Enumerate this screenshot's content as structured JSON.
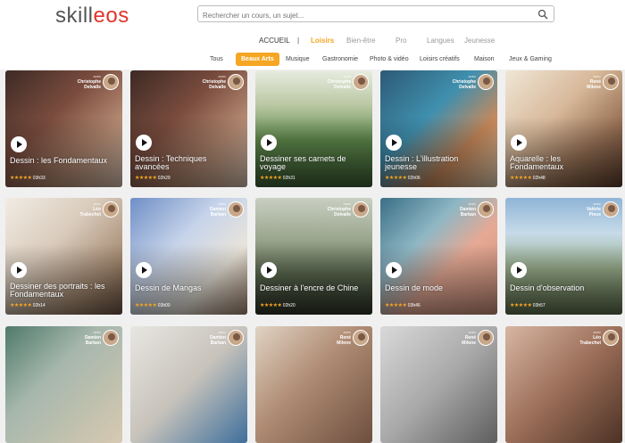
{
  "brand": {
    "logo_text_a": "skill",
    "logo_text_b": "eos"
  },
  "search": {
    "placeholder": "Rechercher un cours, un sujet..."
  },
  "topnav": {
    "home": "ACCUEIL",
    "separator": "|",
    "items": [
      "Loisirs",
      "Bien-être",
      "Pro",
      "Langues",
      "Jeunesse"
    ]
  },
  "categories": [
    "Tous",
    "Beaux Arts",
    "Musique",
    "Gastronomie",
    "Photo & vidéo",
    "Loisirs créatifs",
    "Maison",
    "Jeux & Gaming"
  ],
  "active_category": "Beaux Arts",
  "colors": {
    "accent": "#f5a623",
    "brand_red": "#e0352b",
    "header_bg": "#ffffff",
    "page_bg": "#f0f0f0"
  },
  "courses": [
    {
      "avec": "avec",
      "author_1": "Christophe",
      "author_2": "Delvalle",
      "title_1": "Dessin : les Fondamentaux",
      "title_2": "",
      "stars": "★★★★★",
      "duration": "03h33"
    },
    {
      "avec": "avec",
      "author_1": "Christophe",
      "author_2": "Delvalle",
      "title_1": "Dessin : Techniques",
      "title_2": "avancées",
      "stars": "★★★★★",
      "duration": "02h29"
    },
    {
      "avec": "avec",
      "author_1": "Christophe",
      "author_2": "Delvalle",
      "title_1": "Dessiner ses carnets de",
      "title_2": "voyage",
      "stars": "★★★★★",
      "duration": "02h31"
    },
    {
      "avec": "avec",
      "author_1": "Christophe",
      "author_2": "Delvalle",
      "title_1": "Dessin : L'illustration",
      "title_2": "jeunesse",
      "stars": "★★★★★",
      "duration": "02h06"
    },
    {
      "avec": "avec",
      "author_1": "René",
      "author_2": "Milone",
      "title_1": "Aquarelle : les",
      "title_2": "Fondamentaux",
      "stars": "★★★★★",
      "duration": "02h48"
    },
    {
      "avec": "avec",
      "author_1": "Léo",
      "author_2": "Trabechet",
      "title_1": "Dessiner des portraits : les",
      "title_2": "Fondamentaux",
      "stars": "★★★★★",
      "duration": "02h14"
    },
    {
      "avec": "avec",
      "author_1": "Damien",
      "author_2": "Barban",
      "title_1": "Dessin de Mangas",
      "title_2": "",
      "stars": "★★★★★",
      "duration": "03h00"
    },
    {
      "avec": "avec",
      "author_1": "Christophe",
      "author_2": "Delvalle",
      "title_1": "Dessiner à l'encre de Chine",
      "title_2": "",
      "stars": "★★★★★",
      "duration": "02h20"
    },
    {
      "avec": "avec",
      "author_1": "Damien",
      "author_2": "Barban",
      "title_1": "Dessin de mode",
      "title_2": "",
      "stars": "★★★★★",
      "duration": "03h46"
    },
    {
      "avec": "avec",
      "author_1": "Valérie",
      "author_2": "Pieux",
      "title_1": "Dessin d'observation",
      "title_2": "",
      "stars": "★★★★★",
      "duration": "03h57"
    },
    {
      "avec": "avec",
      "author_1": "Damien",
      "author_2": "Barban",
      "title_1": "",
      "title_2": "",
      "stars": "",
      "duration": ""
    },
    {
      "avec": "avec",
      "author_1": "Damien",
      "author_2": "Barban",
      "title_1": "",
      "title_2": "",
      "stars": "",
      "duration": ""
    },
    {
      "avec": "avec",
      "author_1": "René",
      "author_2": "Milone",
      "title_1": "",
      "title_2": "",
      "stars": "",
      "duration": ""
    },
    {
      "avec": "avec",
      "author_1": "René",
      "author_2": "Milone",
      "title_1": "",
      "title_2": "",
      "stars": "",
      "duration": ""
    },
    {
      "avec": "avec",
      "author_1": "Léo",
      "author_2": "Trabechet",
      "title_1": "",
      "title_2": "",
      "stars": "",
      "duration": ""
    }
  ]
}
